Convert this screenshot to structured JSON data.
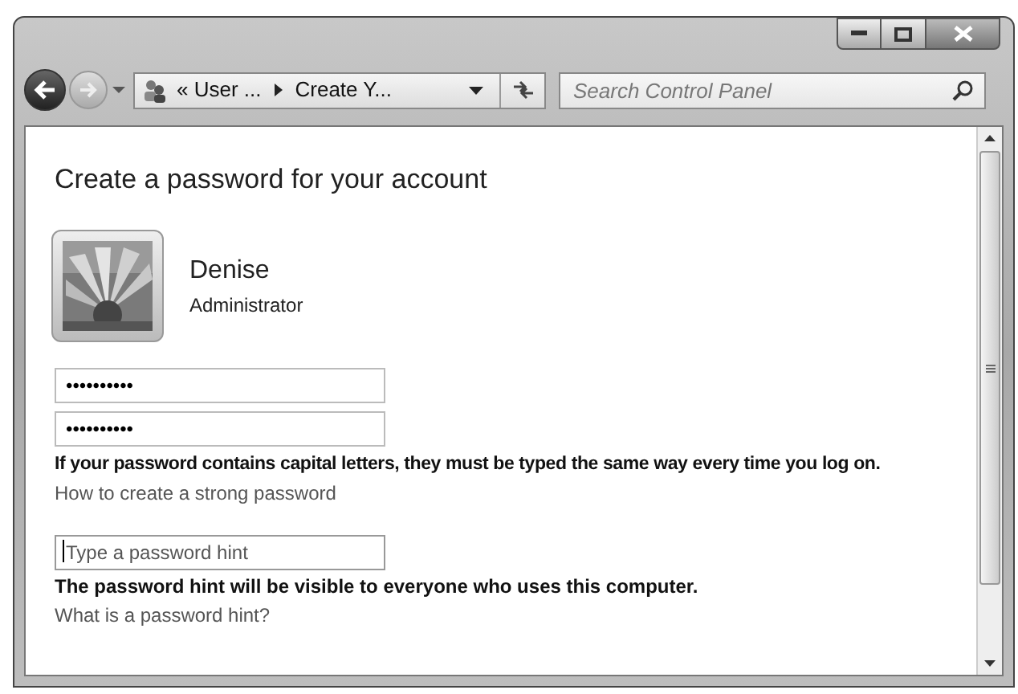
{
  "breadcrumb": {
    "items": [
      "« User ...",
      "Create Y..."
    ]
  },
  "search": {
    "placeholder": "Search Control Panel"
  },
  "heading": "Create a password for your account",
  "user": {
    "name": "Denise",
    "role": "Administrator"
  },
  "password_fields": [
    {
      "value": "••••••••••"
    },
    {
      "value": "••••••••••"
    }
  ],
  "capital_note": "If your password contains capital letters, they must be typed the same way every time you log on.",
  "strong_link": "How to create a strong password",
  "hint_field": {
    "placeholder": "Type a password hint"
  },
  "hint_note": "The password hint will be visible to everyone who uses this computer.",
  "hint_link": "What is a password hint?"
}
